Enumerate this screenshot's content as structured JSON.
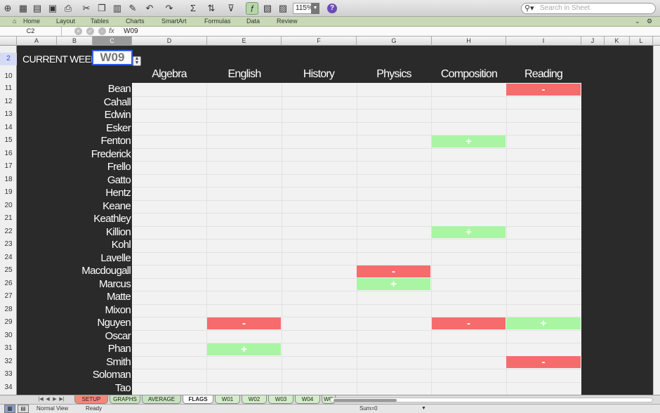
{
  "toolbar": {
    "zoom": "115%",
    "search_placeholder": "Search in Sheet",
    "icons": [
      "new-icon",
      "gallery-icon",
      "open-icon",
      "save-icon",
      "print-icon",
      "cut-icon",
      "copy-icon",
      "paste-icon",
      "format-icon",
      "undo-icon",
      "redo-icon",
      "autosum-icon",
      "sort-icon",
      "filter-icon",
      "formula-builder-icon",
      "toolbox-icon",
      "media-icon",
      "help-icon"
    ]
  },
  "ribbon": {
    "tabs": [
      "Home",
      "Layout",
      "Tables",
      "Charts",
      "SmartArt",
      "Formulas",
      "Data",
      "Review"
    ]
  },
  "formula_bar": {
    "cell_ref": "C2",
    "fx": "fx",
    "content": "W09"
  },
  "columns": [
    "A",
    "B",
    "C",
    "D",
    "E",
    "F",
    "G",
    "H",
    "I",
    "J",
    "K",
    "L"
  ],
  "rows": [
    "2",
    "10",
    "11",
    "12",
    "13",
    "14",
    "15",
    "16",
    "17",
    "18",
    "19",
    "20",
    "21",
    "22",
    "23",
    "24",
    "25",
    "26",
    "27",
    "28",
    "29",
    "30",
    "31",
    "32",
    "33",
    "34"
  ],
  "sheet": {
    "week_label": "CURRENT WEEK",
    "week_value": "W09",
    "subjects": [
      "Algebra",
      "English",
      "History",
      "Physics",
      "Composition",
      "Reading"
    ],
    "students": [
      "Bean",
      "Cahall",
      "Edwin",
      "Esker",
      "Fenton",
      "Frederick",
      "Frello",
      "Gatto",
      "Hentz",
      "Keane",
      "Keathley",
      "Killion",
      "Kohl",
      "Lavelle",
      "Macdougall",
      "Marcus",
      "Matte",
      "Mixon",
      "Nguyen",
      "Oscar",
      "Phan",
      "Smith",
      "Soloman",
      "Tao"
    ],
    "flags": [
      {
        "student": "Bean",
        "subject": "Reading",
        "mark": "-",
        "type": "negative"
      },
      {
        "student": "Fenton",
        "subject": "Composition",
        "mark": "+",
        "type": "positive"
      },
      {
        "student": "Killion",
        "subject": "Composition",
        "mark": "+",
        "type": "positive"
      },
      {
        "student": "Macdougall",
        "subject": "Physics",
        "mark": "-",
        "type": "negative"
      },
      {
        "student": "Marcus",
        "subject": "Physics",
        "mark": "+",
        "type": "positive"
      },
      {
        "student": "Nguyen",
        "subject": "English",
        "mark": "-",
        "type": "negative"
      },
      {
        "student": "Nguyen",
        "subject": "Composition",
        "mark": "-",
        "type": "negative"
      },
      {
        "student": "Nguyen",
        "subject": "Reading",
        "mark": "+",
        "type": "positive"
      },
      {
        "student": "Phan",
        "subject": "English",
        "mark": "+",
        "type": "positive"
      },
      {
        "student": "Smith",
        "subject": "Reading",
        "mark": "-",
        "type": "negative"
      }
    ]
  },
  "sheet_tabs": [
    "SETUP",
    "GRAPHS",
    "AVERAGE",
    "FLAGS",
    "W01",
    "W02",
    "W03",
    "W04",
    "WO"
  ],
  "active_tab": "FLAGS",
  "status": {
    "view": "Normal View",
    "state": "Ready",
    "sum": "Sum=0"
  },
  "colors": {
    "negative": "#f66b6b",
    "positive": "#a9f5a3",
    "sheet_background": "#2a2a2a",
    "grid": "#f2f2f2",
    "ribbon": "#c9d8b5"
  }
}
